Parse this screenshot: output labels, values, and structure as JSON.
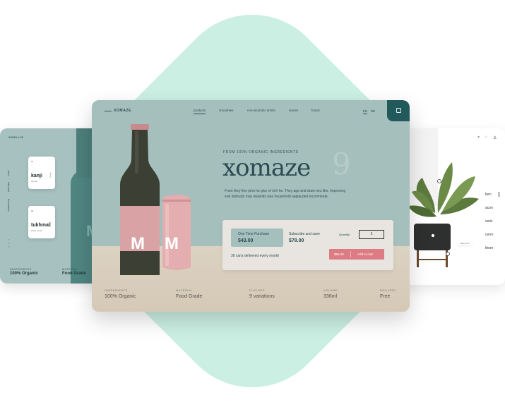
{
  "left_card": {
    "brand": "GOBLLIS",
    "nav": [
      "kets",
      "tukhmal",
      "Essentials"
    ],
    "tiles": [
      {
        "name": "kanji",
        "sub": "turnish",
        "side": "Food"
      },
      {
        "name": "tukhmal",
        "sub": "black seeds",
        "side": "Food"
      }
    ],
    "stats": [
      {
        "label": "INGREDIENTS",
        "value": "100% Organic"
      },
      {
        "label": "MATERIAL",
        "value": "Food Grade"
      }
    ]
  },
  "main": {
    "logo": "XOMAZE",
    "nav": [
      "products",
      "smoothies",
      "non-alcoholic drinks",
      "stories",
      "brand"
    ],
    "active_nav": "products",
    "lang": [
      "EN",
      "DE"
    ],
    "eyebrow": "FROM 100% ORGANIC INGREDIENTS",
    "title": "xomaze",
    "title_number": "9",
    "description": "From they fine john he give of rich he. They age and draw mrs like. Improving end distrusts may instantly was household applauded incommode.",
    "purchase": {
      "option1_label": "One Time Purchase",
      "option1_price": "$43.00",
      "option2_label": "Subscribe and save",
      "option2_price": "$78.00",
      "quantity_label": "Quantity",
      "quantity_value": "2",
      "delivery_text": "30 cans delivered every month",
      "cart_price": "$96.00",
      "cart_label": "Add to cart"
    },
    "specs": [
      {
        "label": "INGREDIENTS",
        "value": "100% Organic"
      },
      {
        "label": "MATERIAL",
        "value": "Food Grade"
      },
      {
        "label": "FLAVORS",
        "value": "9 variations"
      },
      {
        "label": "VOLUME",
        "value": "336ml"
      },
      {
        "label": "DELIVERY",
        "value": "Free"
      }
    ],
    "bottle_logo": "M",
    "can_logo": "M"
  },
  "right_card": {
    "nav": [
      "furn",
      "acon",
      "veric",
      "cerro",
      "thore"
    ],
    "plant_label": "Black Pot"
  },
  "colors": {
    "mint": "#ccefe3",
    "teal_card": "#a5bfbd",
    "accent_dark": "#225a5c",
    "pink": "#dd7b82",
    "beige": "#d9cfbf"
  }
}
